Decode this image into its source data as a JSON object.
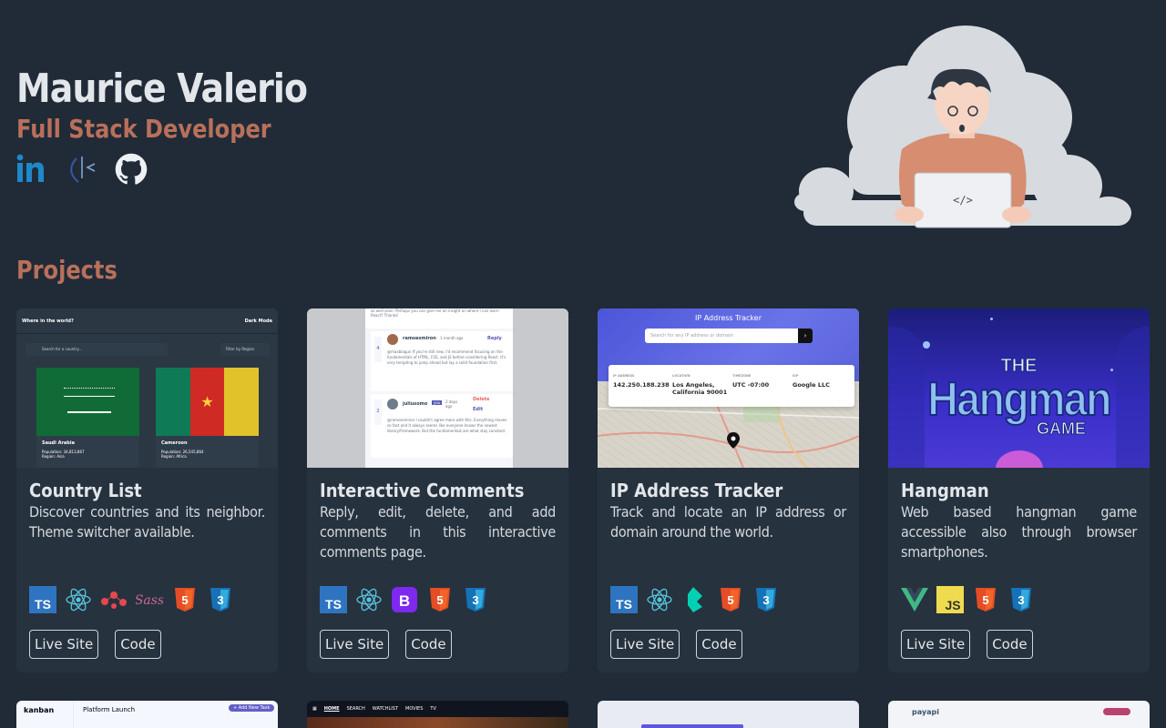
{
  "header": {
    "name": "Maurice Valerio",
    "role": "Full Stack Developer"
  },
  "socials": [
    {
      "icon": "linkedin-icon"
    },
    {
      "icon": "dev-logo-icon"
    },
    {
      "icon": "github-icon"
    }
  ],
  "projects_title": "Projects",
  "colors": {
    "background": "#202b37",
    "card": "#26323e",
    "accent": "#b9705b"
  },
  "projects": [
    {
      "title": "Country List",
      "description": "Discover countries and its neighbor. Theme switcher available.",
      "stack": [
        "typescript-icon",
        "react-icon",
        "redux-saga-icon",
        "sass-icon",
        "html5-icon",
        "css3-icon"
      ],
      "live_label": "Live Site",
      "code_label": "Code",
      "thumb": {
        "app_title": "Where in the world?",
        "mode_label": "Dark Mode",
        "search_placeholder": "Search for a country...",
        "filter_label": "Filter by Region",
        "countries": [
          {
            "name": "Saudi Arabia",
            "population": "Population: 34,813,867",
            "region": "Region: Asia"
          },
          {
            "name": "Cameroon",
            "population": "Population: 26,545,864",
            "region": "Region: Africa"
          }
        ]
      }
    },
    {
      "title": "Interactive Comments",
      "description": "Reply, edit, delete, and add comments in this interactive comments page.",
      "stack": [
        "typescript-icon",
        "react-icon",
        "bootstrap-icon",
        "html5-icon",
        "css3-icon"
      ],
      "live_label": "Live Site",
      "code_label": "Code",
      "thumb": {
        "top_text": "as well soon. Perhaps you can give me an insight on where I can learn React? Thanks!",
        "user1": "ramsesmiron",
        "time1": "1 month ago",
        "reply_label": "Reply",
        "score1": "4",
        "comment1": "@maxblagun If you're still new, I'd recommend focusing on the fundamentals of HTML, CSS, and JS before considering React. It's very tempting to jump ahead but lay a solid foundation first.",
        "user2": "juliusomo",
        "you_badge": "you",
        "time2": "2 days ago",
        "delete_label": "Delete",
        "edit_label": "Edit",
        "score2": "2",
        "comment2": "@ramsesmiron I couldn't agree more with this. Everything moves so fast and it always seems like everyone knows the newest library/framework. But the fundamentals are what stay constant."
      }
    },
    {
      "title": "IP Address Tracker",
      "description": "Track and locate an IP address or domain around the world.",
      "stack": [
        "typescript-icon",
        "react-icon",
        "bulma-icon",
        "html5-icon",
        "css3-icon"
      ],
      "live_label": "Live Site",
      "code_label": "Code",
      "thumb": {
        "app_title": "IP Address Tracker",
        "search_placeholder": "Search for any IP address or domain",
        "ip_label": "IP ADDRESS",
        "ip_value": "142.250.188.238",
        "location_label": "LOCATION",
        "location_value": "Los Angeles, California 90001",
        "timezone_label": "TIMEZONE",
        "timezone_value": "UTC -07:00",
        "isp_label": "ISP",
        "isp_value": "Google LLC"
      }
    },
    {
      "title": "Hangman",
      "description": "Web based hangman game accessible also through browser smartphones.",
      "stack": [
        "vue-icon",
        "javascript-icon",
        "html5-icon",
        "css3-icon"
      ],
      "live_label": "Live Site",
      "code_label": "Code",
      "thumb": {
        "the": "THE",
        "hangman": "Hangman",
        "game": "GAME"
      }
    }
  ],
  "row2": {
    "kanban_title": "kanban",
    "kanban_board": "Platform Launch",
    "kanban_button": "+ Add New Task",
    "nav_home": "HOME",
    "nav_search": "SEARCH",
    "nav_watchlist": "WATCHLIST",
    "nav_movies": "MOVIES",
    "nav_tv": "TV",
    "payapi_logo": "payapi"
  }
}
